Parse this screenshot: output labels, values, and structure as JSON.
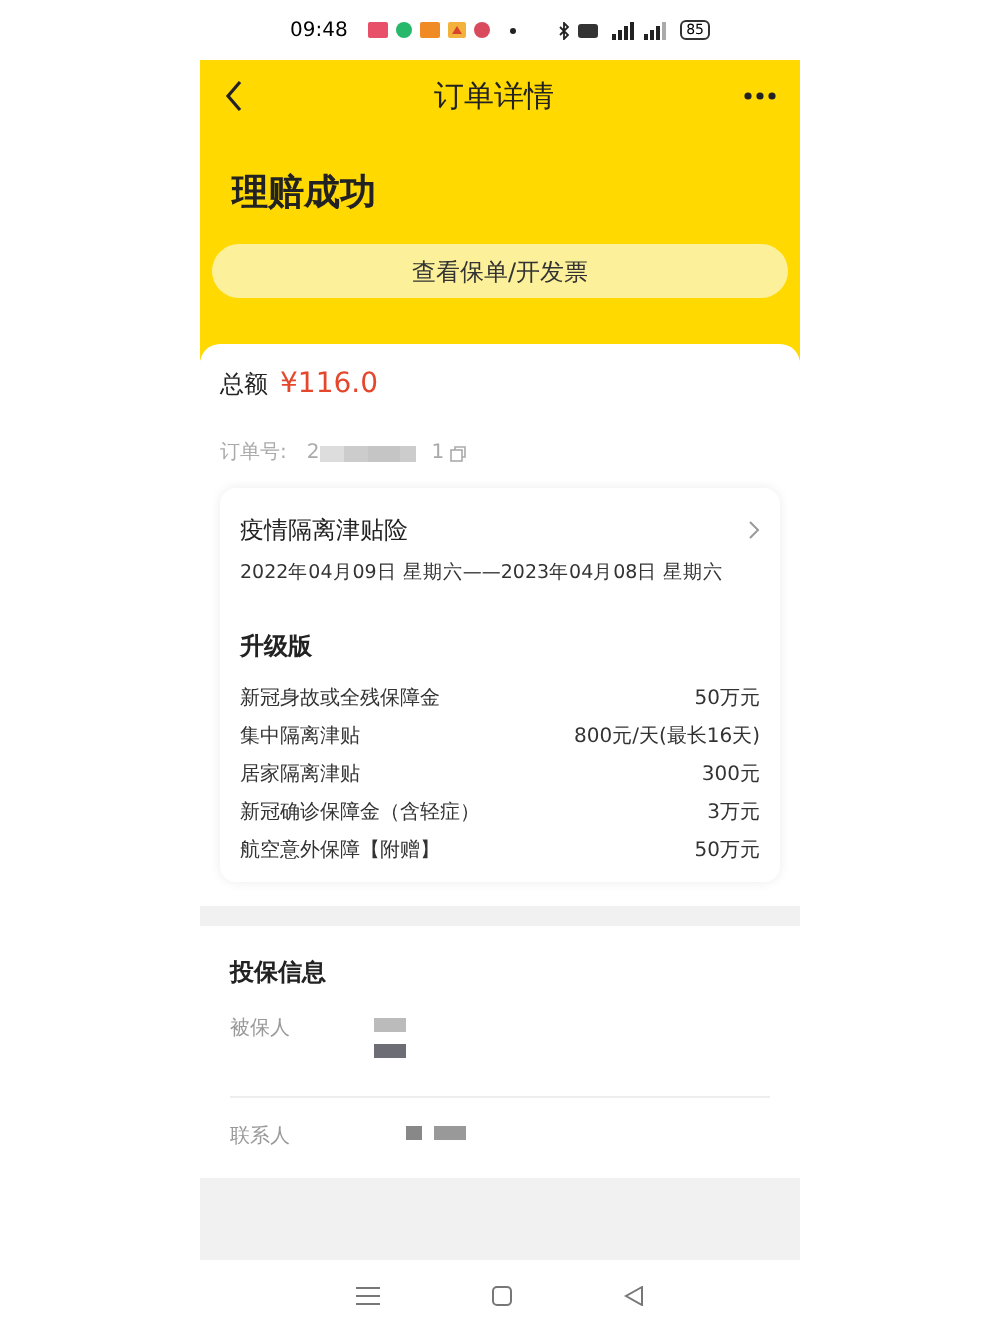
{
  "status_bar": {
    "time": "09:48",
    "battery": "85"
  },
  "nav": {
    "title": "订单详情"
  },
  "status": {
    "title": "理赔成功",
    "button": "查看保单/开发票"
  },
  "total": {
    "label": "总额",
    "amount": "¥116.0"
  },
  "order": {
    "label": "订单号:",
    "number_start": "2",
    "number_end": "1"
  },
  "policy": {
    "name": "疫情隔离津贴险",
    "period": "2022年04月09日 星期六——2023年04月08日 星期六",
    "plan": "升级版",
    "benefits": [
      {
        "label": "新冠身故或全残保障金",
        "value": "50万元"
      },
      {
        "label": "集中隔离津贴",
        "value": "800元/天(最长16天)"
      },
      {
        "label": "居家隔离津贴",
        "value": "300元"
      },
      {
        "label": "新冠确诊保障金（含轻症）",
        "value": "3万元"
      },
      {
        "label": "航空意外保障【附赠】",
        "value": "50万元"
      }
    ]
  },
  "insured_info": {
    "title": "投保信息",
    "rows": [
      {
        "label": "被保人"
      },
      {
        "label": "联系人"
      }
    ]
  }
}
